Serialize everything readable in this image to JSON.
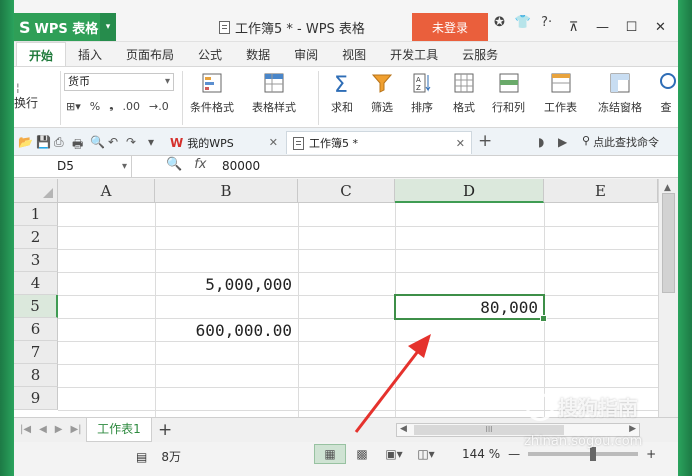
{
  "app": {
    "name": "WPS 表格",
    "logo": "S",
    "window_title": "工作簿5 * - WPS 表格",
    "login_label": "未登录"
  },
  "ribbon_tabs": [
    "开始",
    "插入",
    "页面布局",
    "公式",
    "数据",
    "审阅",
    "视图",
    "开发工具",
    "云服务"
  ],
  "ribbon": {
    "wrap_label": "换行",
    "number_format": "货币",
    "num_buttons": [
      "%",
      "❟",
      ".00",
      "→.0"
    ],
    "buttons": [
      "条件格式",
      "表格样式",
      "求和",
      "筛选",
      "排序",
      "格式",
      "行和列",
      "工作表",
      "冻结窗格",
      "查"
    ]
  },
  "quickbar": {
    "wps_tab": "我的WPS",
    "doc_tab": "工作簿5 *",
    "search_label": "点此查找命令"
  },
  "formula_bar": {
    "cell_ref": "D5",
    "fx": "fx",
    "value": "80000"
  },
  "columns": [
    "A",
    "B",
    "C",
    "D",
    "E"
  ],
  "selected_column": "D",
  "rows": [
    "1",
    "2",
    "3",
    "4",
    "5",
    "6",
    "7",
    "8",
    "9"
  ],
  "selected_row": "5",
  "cells": {
    "B4": "5,000,000",
    "B6": "600,000.00",
    "D5": "80,000"
  },
  "sheet_tab": "工作表1",
  "status": {
    "count": "8万",
    "zoom": "144 %"
  },
  "watermark": {
    "brand": "搜狗指南",
    "url": "zhinan.sogou.com"
  },
  "annotation_color": "#e5322d"
}
